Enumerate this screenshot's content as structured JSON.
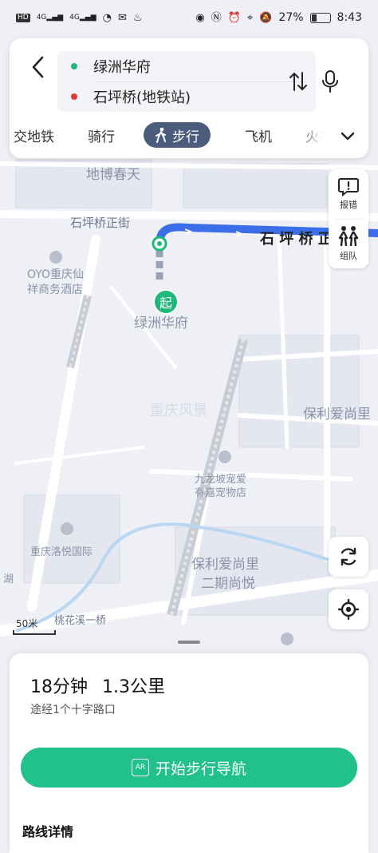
{
  "status_bar": {
    "network": "HD",
    "signal1": "4G",
    "signal2": "4G",
    "battery": "27%",
    "time": "8:43"
  },
  "route": {
    "origin": "绿洲华府",
    "destination": "石坪桥(地铁站)",
    "origin_color": "#1fb87a",
    "destination_color": "#e53935"
  },
  "modes": [
    {
      "label": "交地铁"
    },
    {
      "label": "骑行"
    },
    {
      "label": "步行"
    },
    {
      "label": "飞机"
    },
    {
      "label": "火车"
    }
  ],
  "active_mode": "步行",
  "tools": {
    "report": "报错",
    "team": "组队"
  },
  "map": {
    "labels": {
      "dibo": "地博春天",
      "shipingqiao_street": "石坪桥正街",
      "oyo_line1": "OYO重庆仙",
      "oyo_line2": "祥商务酒店",
      "lvzhou": "绿洲华府",
      "start_marker": "起",
      "shipingqiao_road": "石 坪 桥 正",
      "poly1": "保利爱尚里",
      "pet_line1": "九龙坡宠爱",
      "pet_line2": "有嘉宠物店",
      "luoyue": "重庆洛悦国际",
      "poly2_line1": "保利爱尚里",
      "poly2_line2": "二期尚悦",
      "taohua": "桃花溪一桥",
      "hu": "湖",
      "watermark": "重庆风景"
    },
    "route_color": "#3b6ee8",
    "scale": "50米"
  },
  "summary": {
    "time": "18分钟",
    "distance": "1.3公里",
    "via": "途经1个十字路口",
    "nav_button": "开始步行导航",
    "nav_ar": "AR",
    "details_title": "路线详情"
  }
}
